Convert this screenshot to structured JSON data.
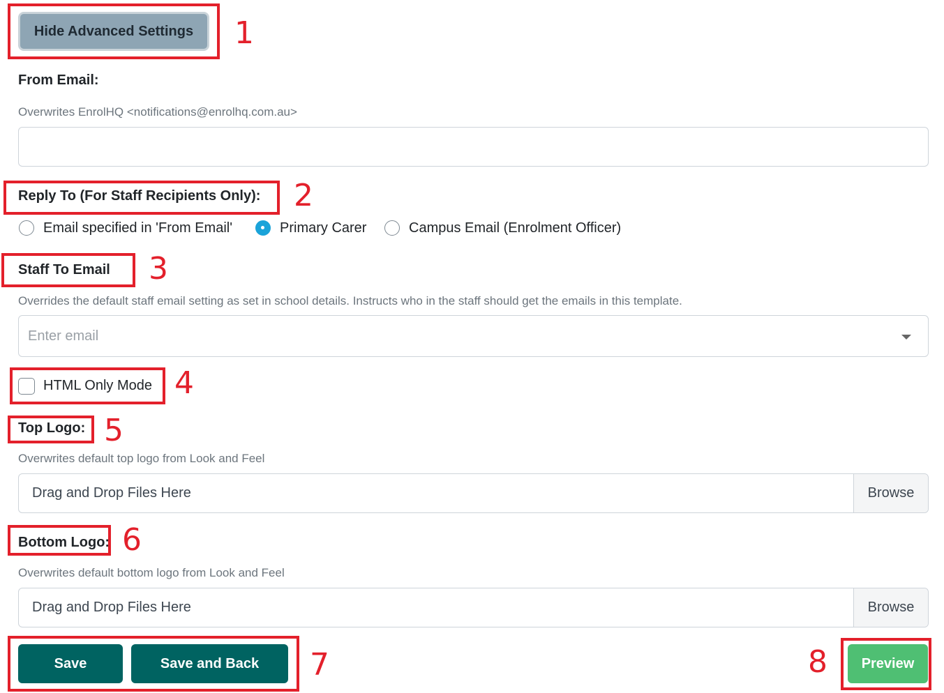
{
  "advanced": {
    "toggle_label": "Hide Advanced Settings"
  },
  "from_email": {
    "label": "From Email:",
    "help": "Overwrites EnrolHQ <notifications@enrolhq.com.au>",
    "value": "",
    "placeholder": ""
  },
  "reply_to": {
    "label": "Reply To (For Staff Recipients Only):",
    "options": [
      {
        "label": "Email specified in 'From Email'",
        "selected": false
      },
      {
        "label": "Primary Carer",
        "selected": true
      },
      {
        "label": "Campus Email (Enrolment Officer)",
        "selected": false
      }
    ]
  },
  "staff_to_email": {
    "label": "Staff To Email",
    "help": "Overrides the default staff email setting as set in school details. Instructs who in the staff should get the emails in this template.",
    "placeholder": "Enter email"
  },
  "html_only": {
    "label": "HTML Only Mode",
    "checked": false
  },
  "top_logo": {
    "label": "Top Logo:",
    "help": "Overwrites default top logo from Look and Feel",
    "drop_text": "Drag and Drop Files Here",
    "browse_label": "Browse"
  },
  "bottom_logo": {
    "label": "Bottom Logo:",
    "help": "Overwrites default bottom logo from Look and Feel",
    "drop_text": "Drag and Drop Files Here",
    "browse_label": "Browse"
  },
  "actions": {
    "save_label": "Save",
    "save_back_label": "Save and Back",
    "preview_label": "Preview"
  },
  "annotations": [
    "1",
    "2",
    "3",
    "4",
    "5",
    "6",
    "7",
    "8"
  ],
  "colors": {
    "annotation_red": "#e3202b",
    "primary_dark": "#006361",
    "preview_green": "#4fbf73",
    "advanced_button": "#8ea5b4",
    "radio_checked": "#1aa3d9"
  }
}
